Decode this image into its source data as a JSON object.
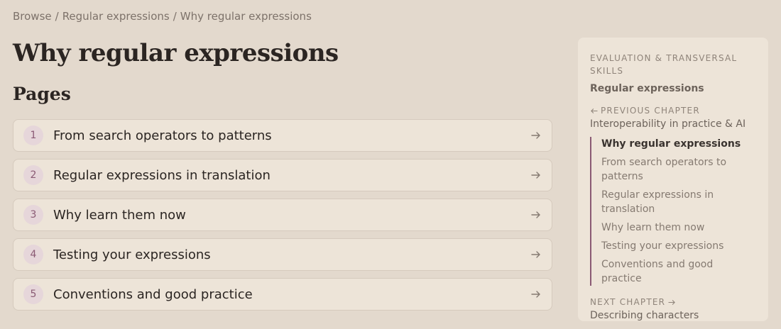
{
  "breadcrumb": {
    "items": [
      "Browse",
      "Regular expressions",
      "Why regular expressions"
    ],
    "separator": "/"
  },
  "page_title": "Why regular expressions",
  "section_title": "Pages",
  "pages": [
    {
      "number": "1",
      "label": "From search operators to patterns"
    },
    {
      "number": "2",
      "label": "Regular expressions in translation"
    },
    {
      "number": "3",
      "label": "Why learn them now"
    },
    {
      "number": "4",
      "label": "Testing your expressions"
    },
    {
      "number": "5",
      "label": "Conventions and good practice"
    }
  ],
  "sidebar": {
    "eyebrow": "EVALUATION & TRANSVERSAL SKILLS",
    "book": "Regular expressions",
    "previous_label": "PREVIOUS CHAPTER",
    "previous_link": "Interoperability in practice & AI",
    "toc": [
      "Why regular expressions",
      "From search operators to patterns",
      "Regular expressions in translation",
      "Why learn them now",
      "Testing your expressions",
      "Conventions and good practice"
    ],
    "next_label": "NEXT CHAPTER",
    "next_link": "Describing characters"
  },
  "icons": {
    "page_arrow": "arrow-right-icon",
    "previous": "arrow-left-icon",
    "next": "arrow-right-icon"
  },
  "colors": {
    "background": "#e3d9cd",
    "card": "#ede4d8",
    "accent": "#8a5a74",
    "number_badge": "#e6d6da"
  }
}
